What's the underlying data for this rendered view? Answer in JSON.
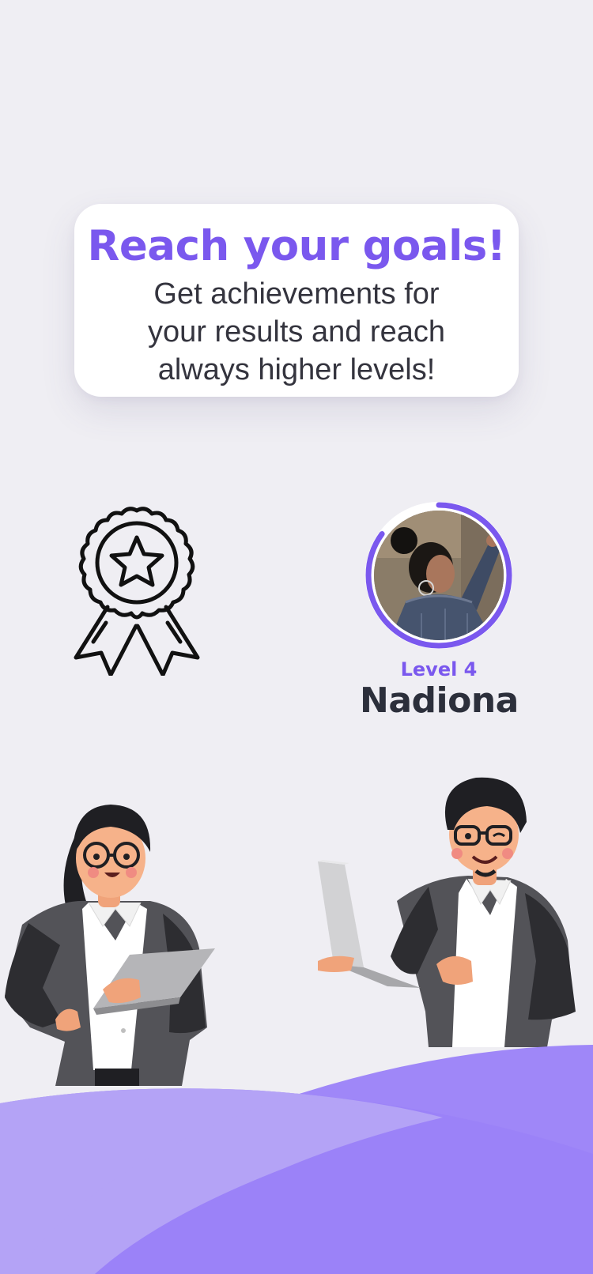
{
  "card": {
    "title": "Reach your goals!",
    "body": "Get achievements for your results and reach always higher levels!"
  },
  "award": {
    "icon": "award-ribbon-star-icon"
  },
  "profile": {
    "level_label": "Level 4",
    "name": "Nadiona",
    "level_progress": 0.85
  },
  "colors": {
    "accent": "#7a58ee",
    "background": "#efeef3",
    "wave_light": "#b4a3f6",
    "wave_dark": "#9a81f8",
    "text_dark": "#2c2f3b"
  }
}
